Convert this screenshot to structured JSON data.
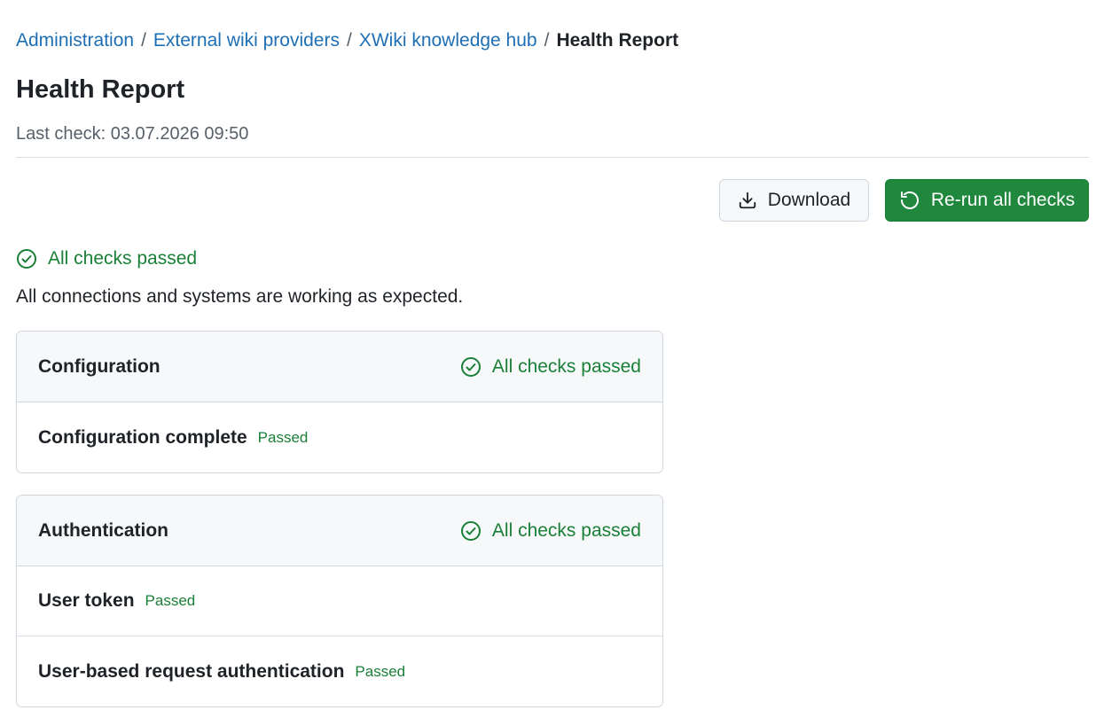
{
  "breadcrumb": {
    "items": [
      "Administration",
      "External wiki providers",
      "XWiki knowledge hub"
    ],
    "separator": "/",
    "current": "Health Report"
  },
  "page": {
    "title": "Health Report",
    "last_check": "Last check: 03.07.2026 09:50"
  },
  "actions": {
    "download_label": "Download",
    "rerun_label": "Re-run all checks"
  },
  "summary": {
    "status": "All checks passed",
    "description": "All connections and systems are working as expected."
  },
  "sections": [
    {
      "title": "Configuration",
      "status": "All checks passed",
      "checks": [
        {
          "name": "Configuration complete",
          "status": "Passed"
        }
      ]
    },
    {
      "title": "Authentication",
      "status": "All checks passed",
      "checks": [
        {
          "name": "User token",
          "status": "Passed"
        },
        {
          "name": "User-based request authentication",
          "status": "Passed"
        }
      ]
    }
  ],
  "colors": {
    "link": "#1f6fb5",
    "success": "#1a7f37",
    "primary_button": "#1f883d",
    "card_header_bg": "#f6f8fa",
    "border": "#d0d7de"
  },
  "icons": {
    "download": "download-icon",
    "rerun": "refresh-icon",
    "status": "check-circle-icon"
  }
}
